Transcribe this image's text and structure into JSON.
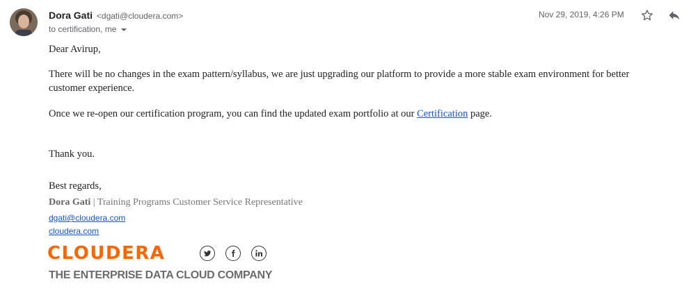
{
  "header": {
    "sender_name": "Dora Gati",
    "sender_email": "<dgati@cloudera.com>",
    "recipients": "to certification, me",
    "date": "Nov 29, 2019, 4:26 PM",
    "icons": [
      "star-icon",
      "reply-icon",
      "chevron-down-icon"
    ]
  },
  "message": {
    "greeting": "Dear Avirup,",
    "paragraph1": "There will be no changes in the exam pattern/syllabus, we are just upgrading our platform to provide a more stable exam environment for better customer experience.",
    "paragraph2_pre": "Once we re-open our certification program, you can find the updated exam portfolio at our ",
    "paragraph2_link": "Certification",
    "paragraph2_post": " page.",
    "thanks": "Thank you."
  },
  "signature": {
    "closing": "Best regards,",
    "name": "Dora Gati",
    "separator": "|",
    "title": "Training Programs Customer Service Representative",
    "email": "dgati@cloudera.com",
    "website": "cloudera.com",
    "logo_text": "CLOUDERA",
    "tagline": "THE ENTERPRISE DATA CLOUD COMPANY",
    "social_icons": [
      "twitter-icon",
      "facebook-icon",
      "linkedin-icon"
    ],
    "brand_color": "#f96702"
  }
}
